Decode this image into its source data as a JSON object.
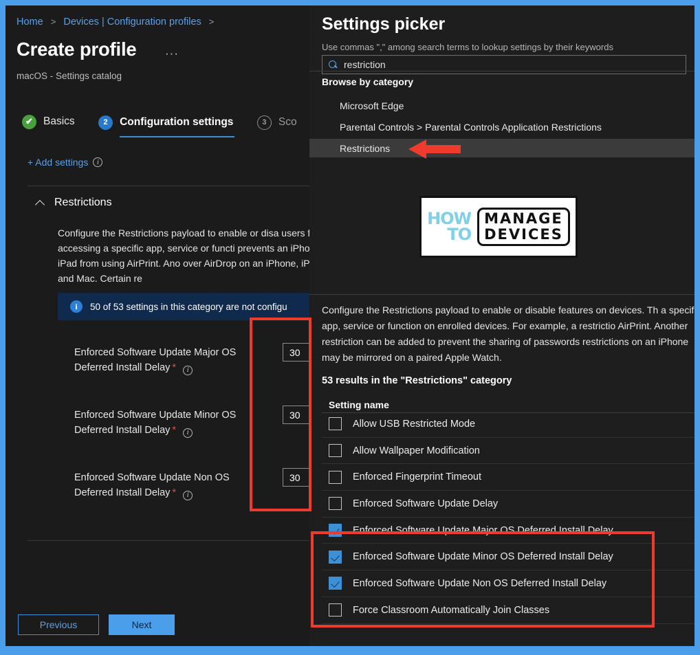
{
  "left": {
    "breadcrumb": {
      "home": "Home",
      "devices": "Devices | Configuration profiles"
    },
    "page_title": "Create profile",
    "ellipsis": "···",
    "page_subtitle": "macOS - Settings catalog",
    "tabs": [
      {
        "badge": "✔",
        "label": "Basics",
        "state": "done"
      },
      {
        "badge": "2",
        "label": "Configuration settings",
        "state": "active"
      },
      {
        "badge": "3",
        "label": "Sco",
        "state": "todo"
      }
    ],
    "add_settings": "+ Add settings",
    "section_title": "Restrictions",
    "section_desc": "Configure the Restrictions payload to enable or disa users from accessing a specific app, service or functi prevents an iPhone or iPad from using AirPrint. Ano over AirDrop on an iPhone, iPad and Mac. Certain re",
    "info_banner": "50 of 53 settings in this category are not configu",
    "settings": [
      {
        "label": "Enforced Software Update Major OS Deferred Install Delay",
        "value": "30",
        "required": "*"
      },
      {
        "label": "Enforced Software Update Minor OS Deferred Install Delay",
        "value": "30",
        "required": "*"
      },
      {
        "label": "Enforced Software Update Non OS Deferred Install Delay",
        "value": "30",
        "required": "*"
      }
    ],
    "buttons": {
      "previous": "Previous",
      "next": "Next"
    }
  },
  "picker": {
    "title": "Settings picker",
    "subtitle": "Use commas \",\" among search terms to lookup settings by their keywords",
    "search_value": "restriction",
    "search_placeholder": "Search",
    "browse_head": "Browse by category",
    "categories": [
      {
        "label": "Microsoft Edge",
        "selected": false
      },
      {
        "label": "Parental Controls > Parental Controls Application Restrictions",
        "selected": false
      },
      {
        "label": "Restrictions",
        "selected": true
      }
    ],
    "watermark": {
      "how": "HOW",
      "to": "TO",
      "line1": "MANAGE",
      "line2": "DEVICES"
    },
    "description": "Configure the Restrictions payload to enable or disable features on devices. Th a specific app, service or function on enrolled devices. For example, a restrictio AirPrint. Another restriction can be added to prevent the sharing of passwords restrictions on an iPhone may be mirrored on a paired Apple Watch.",
    "results_count": "53 results in the \"Restrictions\" category",
    "column_header": "Setting name",
    "rows": [
      {
        "label": "",
        "checked": false,
        "partial": true
      },
      {
        "label": "Allow USB Restricted Mode",
        "checked": false
      },
      {
        "label": "Allow Wallpaper Modification",
        "checked": false
      },
      {
        "label": "Enforced Fingerprint Timeout",
        "checked": false
      },
      {
        "label": "Enforced Software Update Delay",
        "checked": false
      },
      {
        "label": "Enforced Software Update Major OS Deferred Install Delay",
        "checked": true
      },
      {
        "label": "Enforced Software Update Minor OS Deferred Install Delay",
        "checked": true
      },
      {
        "label": "Enforced Software Update Non OS Deferred Install Delay",
        "checked": true
      },
      {
        "label": "Force Classroom Automatically Join Classes",
        "checked": false
      }
    ]
  },
  "colors": {
    "frame_border": "#4a9eea",
    "accent_blue": "#3d8fd6",
    "annotation_red": "#ef3b2d",
    "success_green": "#48a23c",
    "required_red": "#e24a4a"
  }
}
